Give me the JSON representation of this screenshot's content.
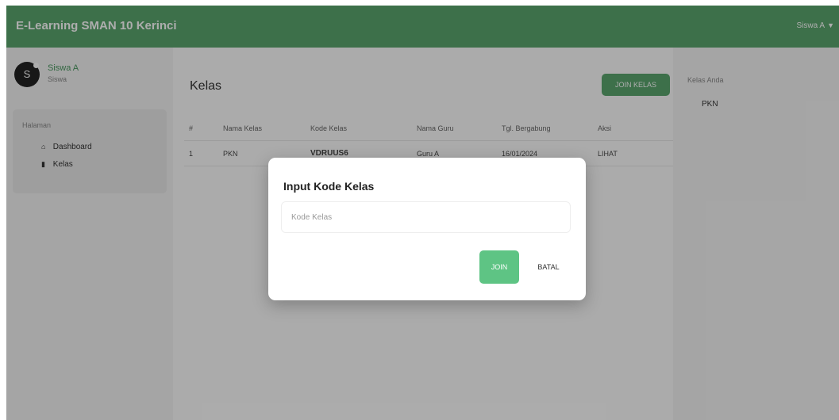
{
  "header": {
    "brand": "E-Learning SMAN 10 Kerinci",
    "user_menu": "Siswa A",
    "caret": "▼",
    "color": "#5aa56e"
  },
  "sidebar": {
    "avatar_initial": "S",
    "profile_name": "Siswa A",
    "profile_role": "Siswa",
    "menu_header": "Halaman",
    "items": [
      {
        "label": "Dashboard",
        "icon": "home-icon",
        "glyph": "⌂"
      },
      {
        "label": "Kelas",
        "icon": "bookmark-icon",
        "glyph": "▮"
      }
    ]
  },
  "main": {
    "title": "Kelas",
    "join_button": "JOIN KELAS",
    "table": {
      "headers": [
        "#",
        "Nama Kelas",
        "Kode Kelas",
        "Nama Guru",
        "Tgl. Bergabung",
        "Aksi"
      ],
      "rows": [
        [
          "1",
          "PKN",
          "VDRUUS6",
          "Guru A",
          "16/01/2024",
          "LIHAT"
        ]
      ]
    }
  },
  "rightbar": {
    "title": "Kelas Anda",
    "items": [
      "PKN"
    ]
  },
  "modal": {
    "title": "Input Kode Kelas",
    "input_placeholder": "Kode Kelas",
    "input_value": "",
    "join_label": "JOIN",
    "cancel_label": "BATAL"
  },
  "colors": {
    "accent": "#5aa56e",
    "join_button": "#5ec484"
  }
}
